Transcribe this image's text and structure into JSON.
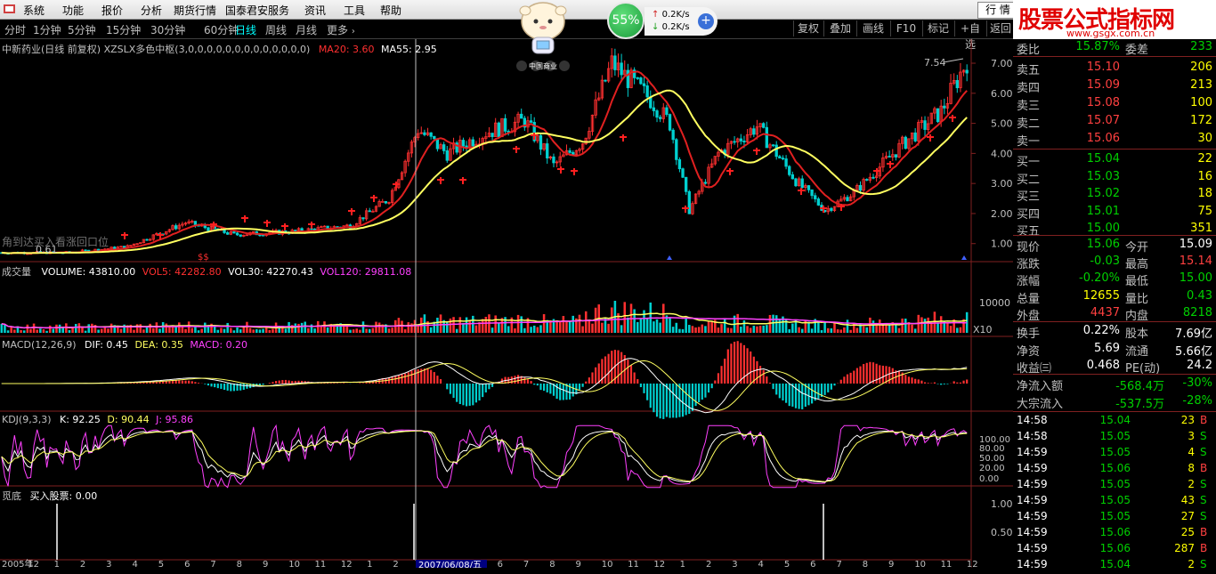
{
  "menu": [
    "系统",
    "功能",
    "报价",
    "分析",
    "期货行情",
    "国泰君安服务",
    "资讯",
    "工具",
    "帮助"
  ],
  "view_button": "行 情",
  "brand": {
    "main": "股票公式指标网",
    "url": "www.gsgx.com.cn"
  },
  "net": {
    "pct": "55%",
    "up": "0.2K/s",
    "down": "0.2K/s"
  },
  "mascot_text": "中国商业",
  "periods": [
    "分时",
    "1分钟",
    "5分钟",
    "15分钟",
    "30分钟",
    "60分钟",
    "日线",
    "周线",
    "月线",
    "更多"
  ],
  "active_period": "日线",
  "right_tools": [
    "复权",
    "叠加",
    "画线",
    "F10",
    "标记",
    "+自选",
    "返回"
  ],
  "main_panel": {
    "title": "中新药业(日线 前复权) XZSLX多色中枢(3,0,0,0,0,0,0,0,0,0,0,0,0,0)",
    "ma20_label": "MA20: 3.60",
    "ma55_label": "MA55: 2.95",
    "price_ticks": [
      "7.00",
      "6.00",
      "5.00",
      "4.00",
      "3.00",
      "2.00",
      "1.00"
    ],
    "high_label": "7.54",
    "low_label": "0.61",
    "faded_text": "角到达买入看涨回口位",
    "ss_marks": "$$"
  },
  "vol_panel": {
    "title": "成交量",
    "volume": "VOLUME: 43810.00",
    "vol5": "VOL5: 42282.80",
    "vol30": "VOL30: 42270.43",
    "vol120": "VOL120: 29811.08",
    "tick": "10000",
    "unit": "X10"
  },
  "macd_panel": {
    "title": "MACD(12,26,9)",
    "dif": "DIF: 0.45",
    "dea": "DEA: 0.35",
    "macd": "MACD: 0.20"
  },
  "kdj_panel": {
    "title": "KDJ(9,3,3)",
    "k": "K: 92.25",
    "d": "D: 90.44",
    "j": "J: 95.86",
    "ticks": [
      "100.00",
      "80.00",
      "50.00",
      "20.00",
      "0.00"
    ]
  },
  "bottom_panel": {
    "title": "觅底",
    "value": "买入股票: 0.00",
    "ticks": [
      "1.00",
      "0.50"
    ]
  },
  "date_axis": [
    "2005年",
    "12",
    "1",
    "2",
    "3",
    "4",
    "5",
    "6",
    "7",
    "8",
    "9",
    "10",
    "11",
    "12",
    "1",
    "2",
    "3",
    "4",
    "5",
    "6",
    "7",
    "8",
    "9",
    "10",
    "11",
    "12",
    "1",
    "2",
    "3",
    "4",
    "5",
    "6",
    "7",
    "8",
    "9",
    "10",
    "11",
    "12"
  ],
  "cursor_date": "2007/06/08/五",
  "quote": {
    "ratio_label": "委比",
    "ratio_val": "15.87%",
    "diff_label": "委差",
    "diff_val": "233",
    "asks": [
      {
        "label": "卖五",
        "price": "15.10",
        "vol": "206"
      },
      {
        "label": "卖四",
        "price": "15.09",
        "vol": "213"
      },
      {
        "label": "卖三",
        "price": "15.08",
        "vol": "100"
      },
      {
        "label": "卖二",
        "price": "15.07",
        "vol": "172"
      },
      {
        "label": "卖一",
        "price": "15.06",
        "vol": "30"
      }
    ],
    "bids": [
      {
        "label": "买一",
        "price": "15.04",
        "vol": "22"
      },
      {
        "label": "买二",
        "price": "15.03",
        "vol": "16"
      },
      {
        "label": "买三",
        "price": "15.02",
        "vol": "18"
      },
      {
        "label": "买四",
        "price": "15.01",
        "vol": "75"
      },
      {
        "label": "买五",
        "price": "15.00",
        "vol": "351"
      }
    ],
    "stats": [
      {
        "l1": "现价",
        "v1": "15.06",
        "c1": "#00d000",
        "l2": "今开",
        "v2": "15.09",
        "c2": "#ffffff"
      },
      {
        "l1": "涨跌",
        "v1": "-0.03",
        "c1": "#00d000",
        "l2": "最高",
        "v2": "15.14",
        "c2": "#ff4040"
      },
      {
        "l1": "涨幅",
        "v1": "-0.20%",
        "c1": "#00d000",
        "l2": "最低",
        "v2": "15.00",
        "c2": "#00d000"
      },
      {
        "l1": "总量",
        "v1": "12655",
        "c1": "#ffff00",
        "l2": "量比",
        "v2": "0.43",
        "c2": "#00d000"
      },
      {
        "l1": "外盘",
        "v1": "4437",
        "c1": "#ff4040",
        "l2": "内盘",
        "v2": "8218",
        "c2": "#00d000"
      }
    ],
    "stats2": [
      {
        "l1": "换手",
        "v1": "0.22%",
        "c1": "#ffffff",
        "l2": "股本",
        "v2": "7.69亿",
        "c2": "#ffffff"
      },
      {
        "l1": "净资",
        "v1": "5.69",
        "c1": "#ffffff",
        "l2": "流通",
        "v2": "5.66亿",
        "c2": "#ffffff"
      },
      {
        "l1": "收益㈢",
        "v1": "0.468",
        "c1": "#ffffff",
        "l2": "PE(动)",
        "v2": "24.2",
        "c2": "#ffffff"
      }
    ],
    "flows": [
      {
        "label": "净流入额",
        "amt": "-568.4万",
        "pct": "-30%"
      },
      {
        "label": "大宗流入",
        "amt": "-537.5万",
        "pct": "-28%"
      }
    ]
  },
  "ticks": [
    {
      "time": "14:58",
      "price": "15.04",
      "vol": "23",
      "side": "B"
    },
    {
      "time": "14:58",
      "price": "15.05",
      "vol": "3",
      "side": "S"
    },
    {
      "time": "14:59",
      "price": "15.05",
      "vol": "4",
      "side": "S"
    },
    {
      "time": "14:59",
      "price": "15.06",
      "vol": "8",
      "side": "B"
    },
    {
      "time": "14:59",
      "price": "15.05",
      "vol": "2",
      "side": "S"
    },
    {
      "time": "14:59",
      "price": "15.05",
      "vol": "43",
      "side": "S"
    },
    {
      "time": "14:59",
      "price": "15.05",
      "vol": "27",
      "side": "S"
    },
    {
      "time": "14:59",
      "price": "15.06",
      "vol": "25",
      "side": "B"
    },
    {
      "time": "14:59",
      "price": "15.06",
      "vol": "287",
      "side": "B"
    },
    {
      "time": "14:59",
      "price": "15.04",
      "vol": "2",
      "side": "S"
    }
  ],
  "colors": {
    "up": "#ff3030",
    "down": "#00d0d0",
    "ma_fast": "#e02020",
    "ma_slow": "#ffff60",
    "magenta": "#ff40ff",
    "grid": "#802020"
  }
}
